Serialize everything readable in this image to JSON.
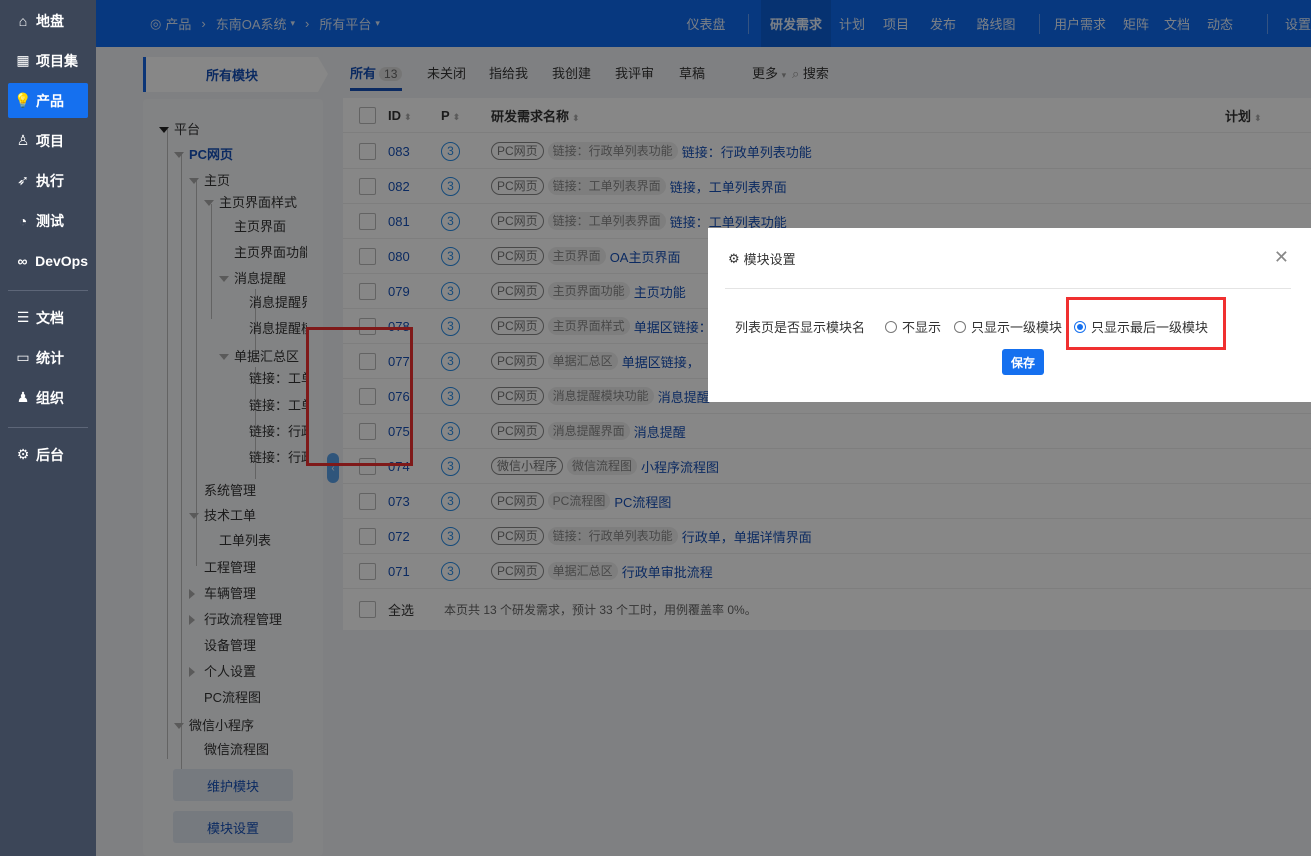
{
  "sidebar": {
    "items": [
      {
        "label": "地盘",
        "icon": "home-icon",
        "glyph": "⌂"
      },
      {
        "label": "项目集",
        "icon": "grid-icon",
        "glyph": "▦"
      },
      {
        "label": "产品",
        "icon": "lightbulb-icon",
        "glyph": "💡",
        "active": true
      },
      {
        "label": "项目",
        "icon": "rocket-icon",
        "glyph": "♙"
      },
      {
        "label": "执行",
        "icon": "running-icon",
        "glyph": "➶"
      },
      {
        "label": "测试",
        "icon": "search-check-icon",
        "glyph": "◔"
      },
      {
        "label": "DevOps",
        "icon": "infinity-icon",
        "glyph": "∞"
      },
      {
        "label": "文档",
        "icon": "document-icon",
        "glyph": "☰"
      },
      {
        "label": "统计",
        "icon": "chart-icon",
        "glyph": "▭"
      },
      {
        "label": "组织",
        "icon": "user-icon",
        "glyph": "♟"
      },
      {
        "label": "后台",
        "icon": "gear-icon",
        "glyph": "⚙"
      }
    ]
  },
  "breadcrumb": {
    "product": "产品",
    "system": "东南OA系统",
    "platform": "所有平台"
  },
  "topnav": [
    "仪表盘",
    "研发需求",
    "计划",
    "项目",
    "发布",
    "路线图",
    "用户需求",
    "矩阵",
    "文档",
    "动态",
    "设置"
  ],
  "module_head": "所有模块",
  "filters": {
    "all": "所有",
    "count": "13",
    "tabs": [
      "未关闭",
      "指给我",
      "我创建",
      "我评审",
      "草稿"
    ],
    "more": "更多",
    "search": "搜索"
  },
  "tree": [
    {
      "label": "平台"
    },
    {
      "label": "PC网页"
    },
    {
      "label": "主页"
    },
    {
      "label": "主页界面样式"
    },
    {
      "label": "主页界面"
    },
    {
      "label": "主页界面功能"
    },
    {
      "label": "消息提醒"
    },
    {
      "label": "消息提醒界面"
    },
    {
      "label": "消息提醒模块功能"
    },
    {
      "label": "单据汇总区"
    },
    {
      "label": "链接：工单"
    },
    {
      "label": "链接：工单"
    },
    {
      "label": "链接：行政"
    },
    {
      "label": "链接：行政"
    },
    {
      "label": "系统管理"
    },
    {
      "label": "技术工单"
    },
    {
      "label": "工单列表"
    },
    {
      "label": "工程管理"
    },
    {
      "label": "车辆管理"
    },
    {
      "label": "行政流程管理"
    },
    {
      "label": "设备管理"
    },
    {
      "label": "个人设置"
    },
    {
      "label": "PC流程图"
    },
    {
      "label": "微信小程序"
    },
    {
      "label": "微信流程图"
    }
  ],
  "tree_buttons": {
    "maintain": "维护模块",
    "settings": "模块设置"
  },
  "table": {
    "headers": {
      "id": "ID",
      "p": "P",
      "name": "研发需求名称",
      "plan": "计划"
    },
    "rows": [
      {
        "id": "083",
        "p": "3",
        "tag": "PC网页",
        "module": "链接：行政单列表功能",
        "title": "链接：行政单列表功能"
      },
      {
        "id": "082",
        "p": "3",
        "tag": "PC网页",
        "module": "链接：工单列表界面",
        "title": "链接，工单列表界面"
      },
      {
        "id": "081",
        "p": "3",
        "tag": "PC网页",
        "module": "链接：工单列表界面",
        "title": "链接：工单列表功能"
      },
      {
        "id": "080",
        "p": "3",
        "tag": "PC网页",
        "module": "主页界面",
        "title": "OA主页界面"
      },
      {
        "id": "079",
        "p": "3",
        "tag": "PC网页",
        "module": "主页界面功能",
        "title": "主页功能"
      },
      {
        "id": "078",
        "p": "3",
        "tag": "PC网页",
        "module": "主页界面样式",
        "title": "单据区链接："
      },
      {
        "id": "077",
        "p": "3",
        "tag": "PC网页",
        "module": "单据汇总区",
        "title": "单据区链接，"
      },
      {
        "id": "076",
        "p": "3",
        "tag": "PC网页",
        "module": "消息提醒模块功能",
        "title": "消息提醒"
      },
      {
        "id": "075",
        "p": "3",
        "tag": "PC网页",
        "module": "消息提醒界面",
        "title": "消息提醒"
      },
      {
        "id": "074",
        "p": "3",
        "tag": "微信小程序",
        "module": "微信流程图",
        "title": "小程序流程图"
      },
      {
        "id": "073",
        "p": "3",
        "tag": "PC网页",
        "module": "PC流程图",
        "title": "PC流程图"
      },
      {
        "id": "072",
        "p": "3",
        "tag": "PC网页",
        "module": "链接：行政单列表功能",
        "title": "行政单，单据详情界面"
      },
      {
        "id": "071",
        "p": "3",
        "tag": "PC网页",
        "module": "单据汇总区",
        "title": "行政单审批流程"
      }
    ],
    "footer": {
      "select_all": "全选",
      "summary": "本页共 13 个研发需求，预计 33 个工时，用例覆盖率 0%。"
    }
  },
  "modal": {
    "title": "模块设置",
    "label": "列表页是否显示模块名",
    "options": [
      "不显示",
      "只显示一级模块",
      "只显示最后一级模块"
    ],
    "selected": "只显示最后一级模块",
    "save": "保存"
  }
}
